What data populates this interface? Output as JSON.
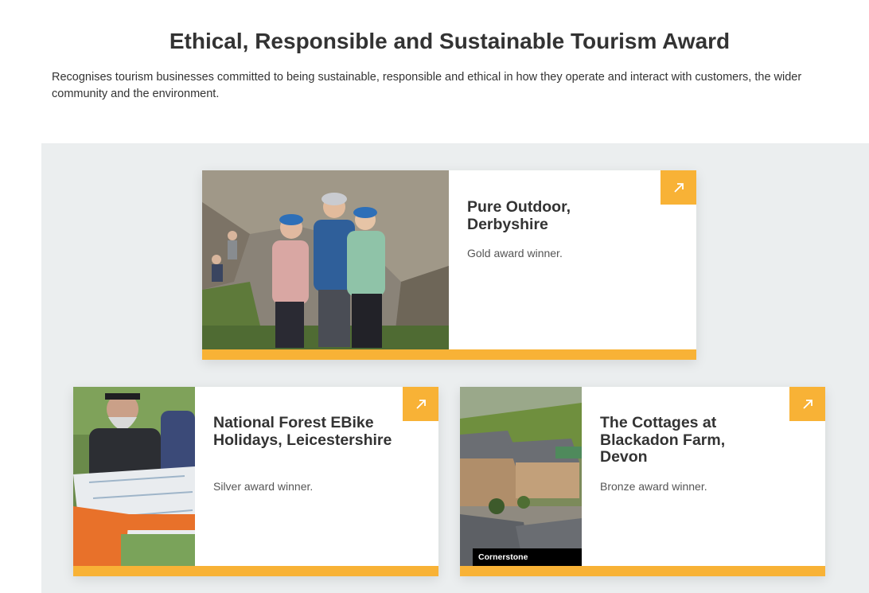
{
  "section": {
    "title": "Ethical, Responsible and Sustainable Tourism Award",
    "description": "Recognises tourism businesses committed to being sustainable, responsible and ethical in how they operate and interact with customers, the wider community and the environment."
  },
  "colors": {
    "accent": "#f8b236",
    "band_background": "#ebeeef",
    "text": "#333333"
  },
  "cards": [
    {
      "title": "Pure Outdoor, Derbyshire",
      "award": "Gold award winner.",
      "image": "climbers-at-rock-face-photo",
      "icon": "arrow-up-right-icon"
    },
    {
      "title": "National Forest EBike Holidays, Leicestershire",
      "award": "Silver award winner.",
      "image": "cyclists-reading-map-photo",
      "icon": "arrow-up-right-icon"
    },
    {
      "title": "The Cottages at Blackadon Farm, Devon",
      "award": "Bronze award winner.",
      "image": "farm-cottages-aerial-photo",
      "photo_credit": "Cornerstone Photography",
      "icon": "arrow-up-right-icon"
    }
  ]
}
